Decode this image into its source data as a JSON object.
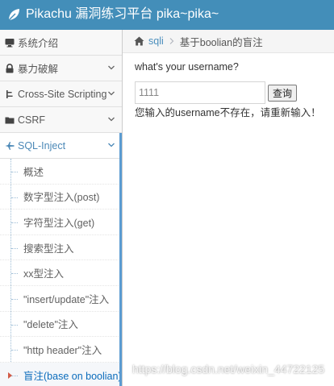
{
  "header": {
    "title": "Pikachu 漏洞练习平台 pika~pika~",
    "logo_icon": "leaf-icon",
    "bg_color": "#438eb9"
  },
  "sidebar": {
    "items": [
      {
        "label": "系统介绍",
        "icon": "desktop-icon"
      },
      {
        "label": "暴力破解",
        "icon": "lock-icon"
      },
      {
        "label": "Cross-Site Scripting",
        "icon": "code-fork-icon"
      },
      {
        "label": "CSRF",
        "icon": "folder-icon"
      },
      {
        "label": "SQL-Inject",
        "icon": "plane-icon"
      }
    ],
    "submenu": [
      {
        "label": "概述"
      },
      {
        "label": "数字型注入(post)"
      },
      {
        "label": "字符型注入(get)"
      },
      {
        "label": "搜索型注入"
      },
      {
        "label": "xx型注入"
      },
      {
        "label": "\"insert/update\"注入"
      },
      {
        "label": "\"delete\"注入"
      },
      {
        "label": "\"http header\"注入"
      },
      {
        "label": "盲注(base on boolian)"
      }
    ]
  },
  "breadcrumb": {
    "section": "sqli",
    "current": "基于boolian的盲注"
  },
  "main": {
    "prompt": "what's your username?",
    "input_value": "1111",
    "submit_label": "查询",
    "result": "您输入的username不存在，请重新输入！"
  },
  "watermark": "https://blog.csdn.net/weixin_44722125"
}
